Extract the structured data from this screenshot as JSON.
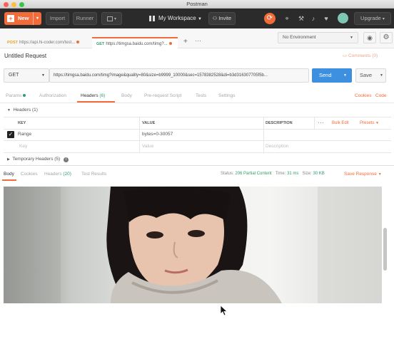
{
  "window": {
    "title": "Postman"
  },
  "header": {
    "new_label": "New",
    "import_label": "Import",
    "runner_label": "Runner",
    "workspace_label": "My Workspace",
    "invite_label": "Invite",
    "upgrade_label": "Upgrade"
  },
  "tabs": [
    {
      "method": "POST",
      "url": "https://api.hi-coder.com/test...",
      "method_color": "#e8a31f"
    },
    {
      "method": "GET",
      "url": "https://timgsa.baidu.com/timg?...",
      "method_color": "#2f9e6a"
    }
  ],
  "environment": {
    "selected": "No Environment"
  },
  "request": {
    "title": "Untitled Request",
    "comments_label": "Comments (0)",
    "method": "GET",
    "url": "https://timgsa.baidu.com/timg?image&quality=80&size=b9999_10000&sec=1578382528&di=b3d316307705f5b...",
    "send_label": "Send",
    "save_label": "Save"
  },
  "request_tabs": {
    "params": "Params",
    "authorization": "Authorization",
    "headers": "Headers",
    "headers_count": "(6)",
    "body": "Body",
    "prerequest": "Pre-request Script",
    "tests": "Tests",
    "settings": "Settings",
    "cookies": "Cookies",
    "code": "Code"
  },
  "headers_section": {
    "title": "Headers",
    "count": "(1)",
    "columns": {
      "key": "KEY",
      "value": "VALUE",
      "description": "DESCRIPTION"
    },
    "bulk_edit": "Bulk Edit",
    "presets": "Presets",
    "rows": [
      {
        "key": "Range",
        "value": "bytes=0-30057",
        "checked": true
      }
    ],
    "placeholder": {
      "key": "Key",
      "value": "Value",
      "description": "Description"
    },
    "temporary_label": "Temporary Headers",
    "temporary_count": "(5)"
  },
  "response": {
    "tabs": {
      "body": "Body",
      "cookies": "Cookies",
      "headers": "Headers",
      "headers_count": "(20)",
      "test_results": "Test Results"
    },
    "status_label": "Status:",
    "status_value": "206 Partial Content",
    "time_label": "Time:",
    "time_value": "31 ms",
    "size_label": "Size:",
    "size_value": "30 KB",
    "save_label": "Save Response"
  },
  "colors": {
    "accent": "#f26b3a",
    "blue": "#3d8fe0",
    "dark": "#2b2b2b",
    "green": "#2f9e6a"
  }
}
